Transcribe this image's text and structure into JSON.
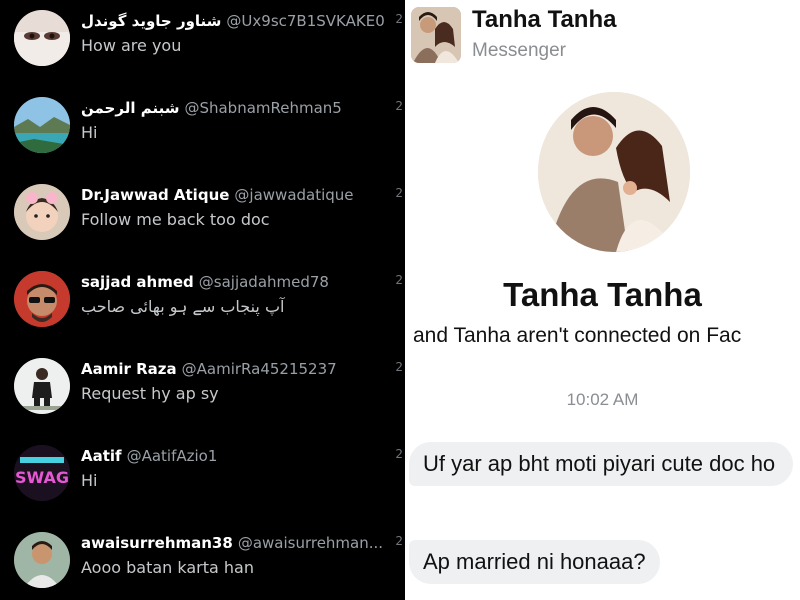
{
  "dm_list": [
    {
      "name": "شناور جاوید گوندل",
      "handle": "@Ux9sc7B1SVKAKE0",
      "message": "How are you",
      "time": "2",
      "message_rtl": false
    },
    {
      "name": "شبنم الرحمن",
      "handle": "@ShabnamRehman5",
      "message": "Hi",
      "time": "2",
      "message_rtl": false
    },
    {
      "name": "Dr.Jawwad Atique",
      "handle": "@jawwadatique",
      "message": "Follow me back too doc",
      "time": "2",
      "message_rtl": false
    },
    {
      "name": "sajjad ahmed",
      "handle": "@sajjadahmed78",
      "message": "آپ پنجاب سے ہو بھائی صاحب",
      "time": "2",
      "message_rtl": true
    },
    {
      "name": "Aamir Raza",
      "handle": "@AamirRa45215237",
      "message": "Request hy ap sy",
      "time": "2",
      "message_rtl": false
    },
    {
      "name": "Aatif",
      "handle": "@AatifAzio1",
      "message": "Hi",
      "time": "2",
      "message_rtl": false
    },
    {
      "name": "awaisurrehman38",
      "handle": "@awaisurrehman...",
      "message": "Aooo batan karta han",
      "time": "2",
      "message_rtl": false
    }
  ],
  "avatar_logo_text": "SWAG",
  "messenger": {
    "header_title": "Tanha Tanha",
    "header_subtitle": "Messenger",
    "profile_name": "Tanha Tanha",
    "profile_subtitle": "and Tanha aren't connected on Fac",
    "timestamp": "10:02 AM",
    "messages": [
      {
        "text": "Uf yar ap bht moti piyari cute doc ho"
      },
      {
        "text": "Ap married ni honaaa?"
      }
    ]
  },
  "colors": {
    "dark_bg": "#000000",
    "light_bg": "#ffffff",
    "bubble_bg": "#eef0f2",
    "muted_text": "#8a8d91"
  }
}
